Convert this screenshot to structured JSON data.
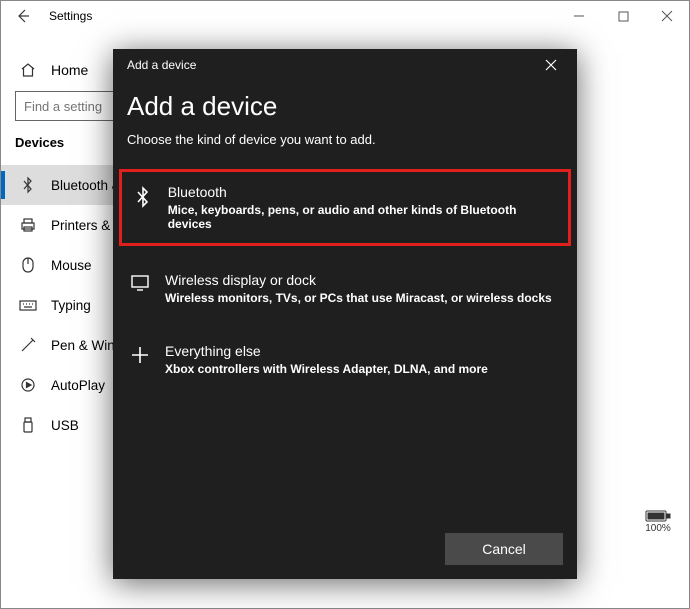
{
  "settings": {
    "window_title": "Settings",
    "home_label": "Home",
    "search_placeholder": "Find a setting",
    "section_header": "Devices",
    "nav": [
      {
        "label": "Bluetooth & other devices"
      },
      {
        "label": "Printers & scanners"
      },
      {
        "label": "Mouse"
      },
      {
        "label": "Typing"
      },
      {
        "label": "Pen & Windows Ink"
      },
      {
        "label": "AutoPlay"
      },
      {
        "label": "USB"
      }
    ],
    "battery_level": "100%"
  },
  "dialog": {
    "titlebar": "Add a device",
    "heading": "Add a device",
    "subtitle": "Choose the kind of device you want to add.",
    "options": [
      {
        "title": "Bluetooth",
        "desc": "Mice, keyboards, pens, or audio and other kinds of Bluetooth devices"
      },
      {
        "title": "Wireless display or dock",
        "desc": "Wireless monitors, TVs, or PCs that use Miracast, or wireless docks"
      },
      {
        "title": "Everything else",
        "desc": "Xbox controllers with Wireless Adapter, DLNA, and more"
      }
    ],
    "cancel_label": "Cancel"
  }
}
